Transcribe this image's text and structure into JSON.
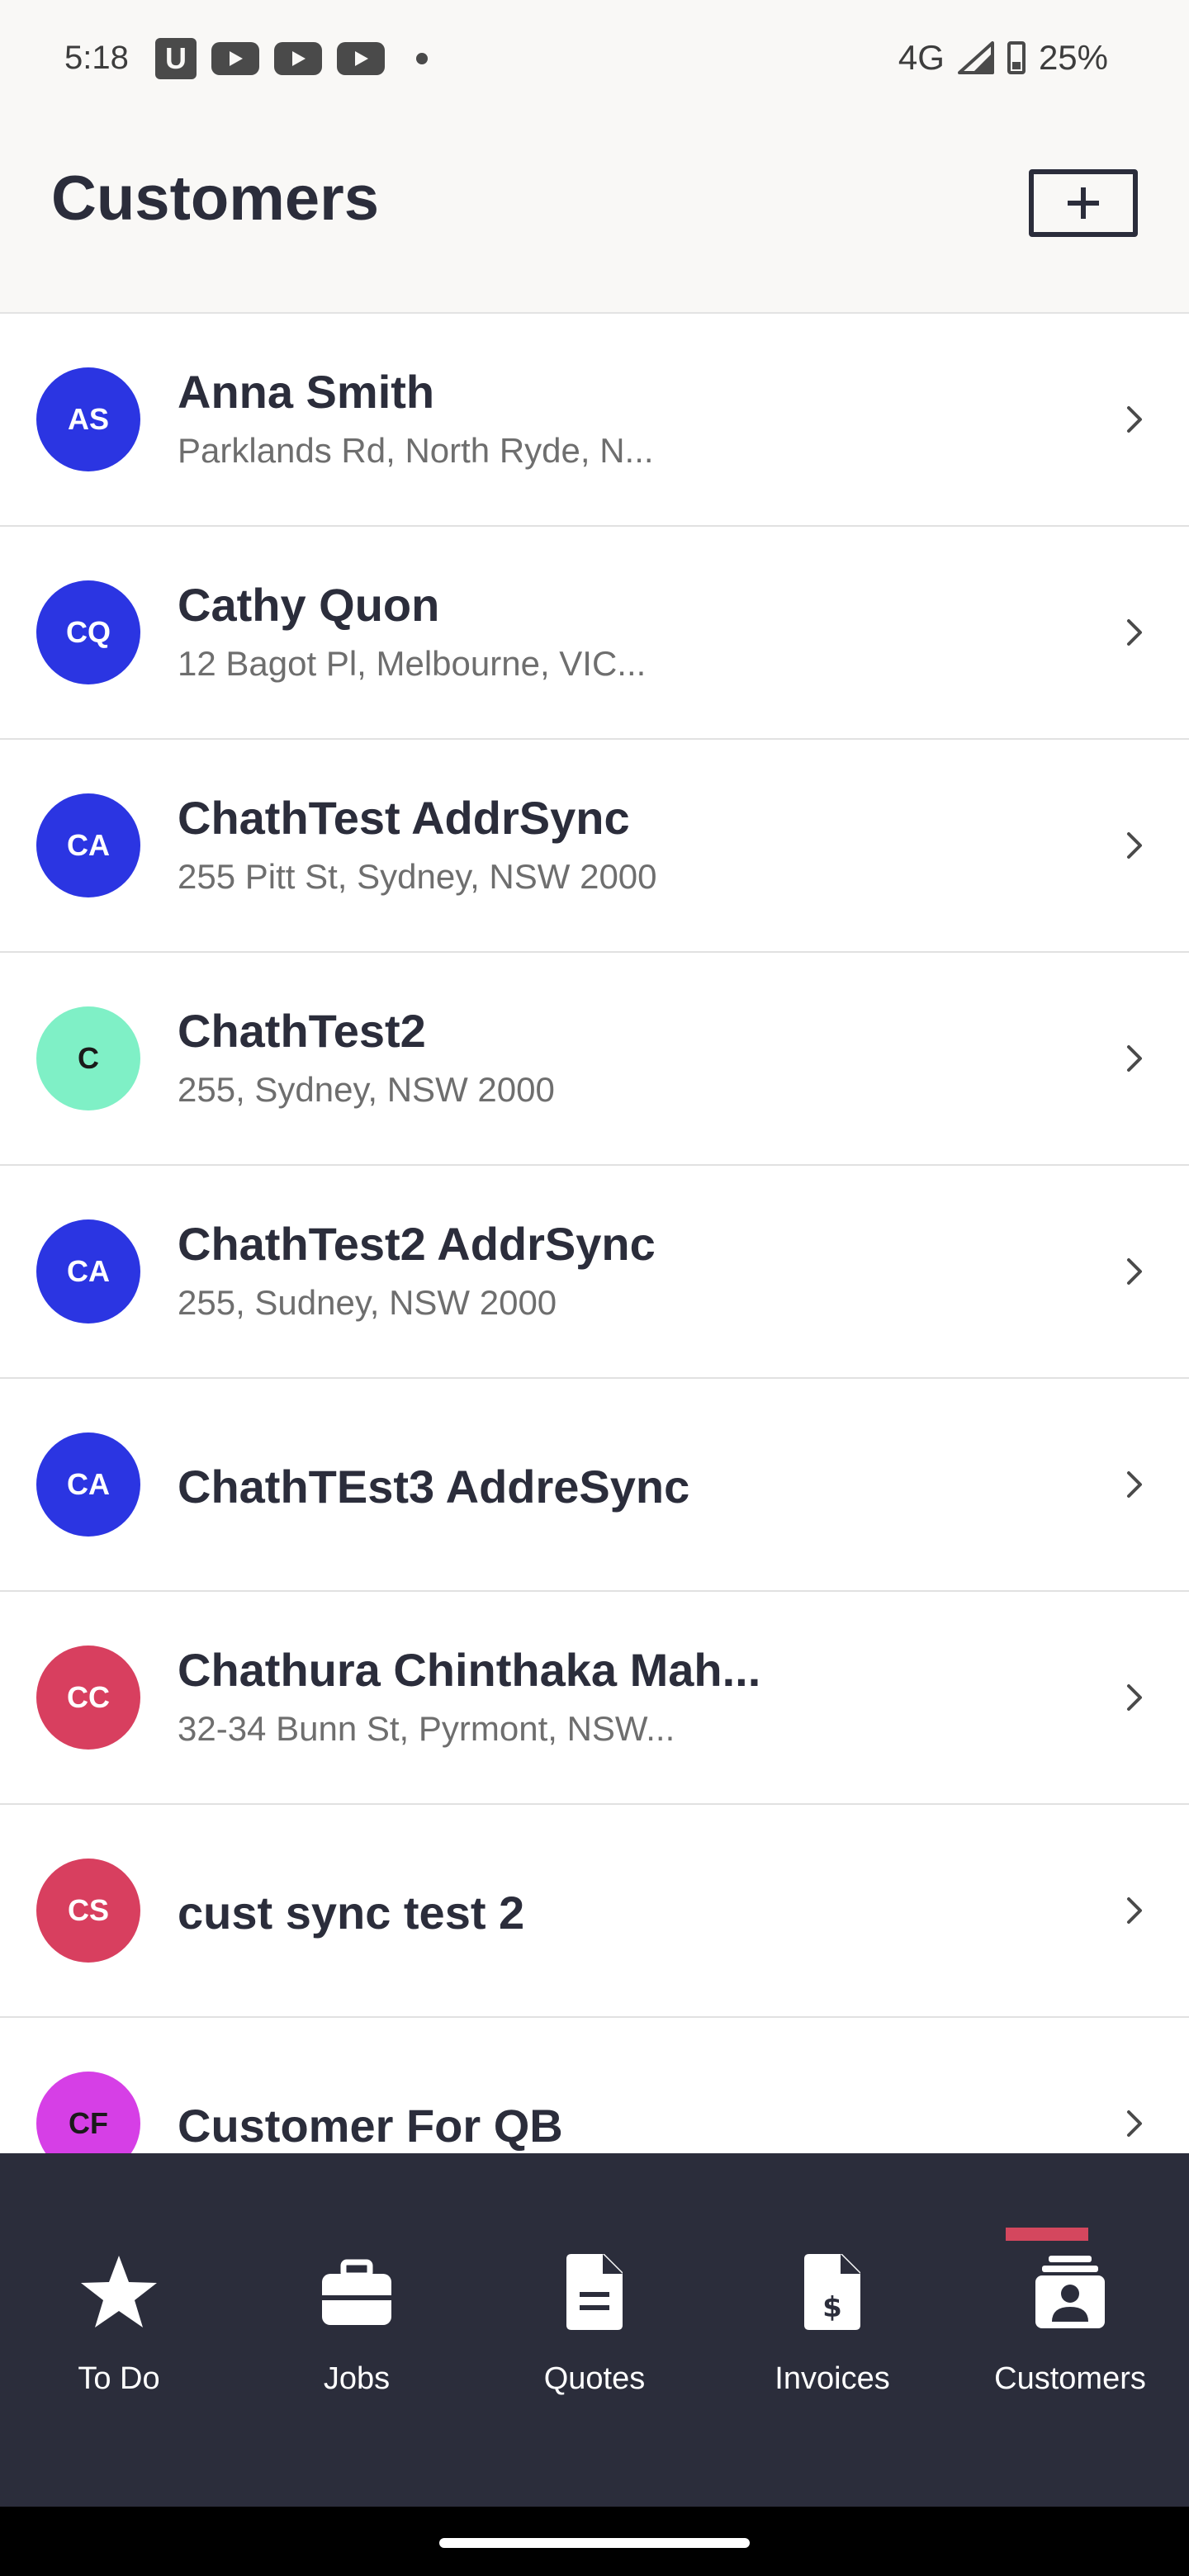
{
  "status_bar": {
    "time": "5:18",
    "app_icon_letter": "U",
    "network": "4G",
    "battery": "25%"
  },
  "header": {
    "title": "Customers"
  },
  "customers": [
    {
      "initials": "AS",
      "name": "Anna Smith",
      "address": "Parklands Rd, North Ryde, N...",
      "avatar_color": "#2b35e2",
      "initials_color": "#ffffff"
    },
    {
      "initials": "CQ",
      "name": "Cathy Quon",
      "address": "12 Bagot Pl, Melbourne, VIC...",
      "avatar_color": "#2b35e2",
      "initials_color": "#ffffff"
    },
    {
      "initials": "CA",
      "name": "ChathTest AddrSync",
      "address": "255 Pitt St, Sydney, NSW 2000",
      "avatar_color": "#2b35e2",
      "initials_color": "#ffffff"
    },
    {
      "initials": "C",
      "name": "ChathTest2",
      "address": "255, Sydney, NSW 2000",
      "avatar_color": "#7ff0c6",
      "initials_color": "#1a1a1a"
    },
    {
      "initials": "CA",
      "name": "ChathTest2 AddrSync",
      "address": "255, Sudney, NSW 2000",
      "avatar_color": "#2b35e2",
      "initials_color": "#ffffff"
    },
    {
      "initials": "CA",
      "name": "ChathTEst3 AddreSync",
      "address": "",
      "avatar_color": "#2b35e2",
      "initials_color": "#ffffff"
    },
    {
      "initials": "CC",
      "name": "Chathura Chinthaka Mah...",
      "address": "32-34 Bunn St, Pyrmont, NSW...",
      "avatar_color": "#d83f5f",
      "initials_color": "#ffffff"
    },
    {
      "initials": "CS",
      "name": "cust sync test 2",
      "address": "",
      "avatar_color": "#d83f5f",
      "initials_color": "#ffffff"
    },
    {
      "initials": "CF",
      "name": "Customer For QB",
      "address": "",
      "avatar_color": "#d63fe6",
      "initials_color": "#1a1a1a"
    }
  ],
  "bottom_nav": {
    "items": [
      {
        "label": "To Do",
        "icon": "star-icon"
      },
      {
        "label": "Jobs",
        "icon": "briefcase-icon"
      },
      {
        "label": "Quotes",
        "icon": "document-icon"
      },
      {
        "label": "Invoices",
        "icon": "invoice-icon"
      },
      {
        "label": "Customers",
        "icon": "contact-card-icon"
      }
    ],
    "active": "Customers",
    "accent_color": "#d4475e"
  },
  "colors": {
    "nav_background": "#2b2d3b",
    "header_background": "#f9f8f6",
    "title_color": "#2b2d3b"
  }
}
